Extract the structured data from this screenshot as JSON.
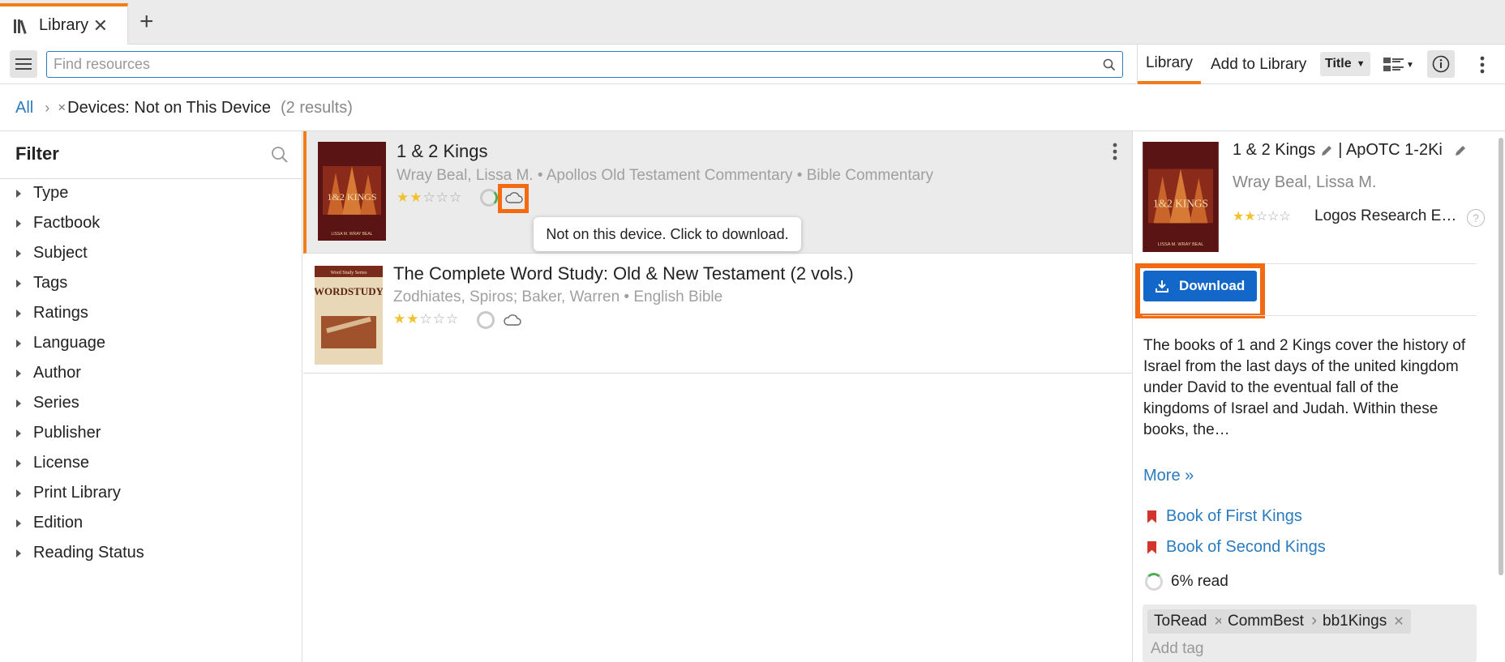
{
  "tabs": [
    {
      "label": "Library"
    }
  ],
  "search": {
    "placeholder": "Find resources",
    "value": ""
  },
  "toolbar": {
    "library_tab": "Library",
    "add_tab": "Add to Library",
    "sort_label": "Title"
  },
  "breadcrumb": {
    "all": "All",
    "filter": "Devices: Not on This Device",
    "results": "(2 results)"
  },
  "filter": {
    "title": "Filter",
    "items": [
      "Type",
      "Factbook",
      "Subject",
      "Tags",
      "Ratings",
      "Language",
      "Author",
      "Series",
      "Publisher",
      "License",
      "Print Library",
      "Edition",
      "Reading Status"
    ]
  },
  "results": [
    {
      "title": "1 & 2 Kings",
      "meta": "Wray Beal, Lissa M. • Apollos Old Testament Commentary • Bible Commentary",
      "rating": 2,
      "cover_title": "1&2 KINGS",
      "cover_author": "LISSA M. WRAY BEAL"
    },
    {
      "title": "The Complete Word Study: Old & New Testament  (2 vols.)",
      "meta": "Zodhiates, Spiros; Baker, Warren • English Bible",
      "rating": 2,
      "cover_series": "Word Study Series",
      "cover_title": "WORDSTUDY"
    }
  ],
  "tooltip": "Not on this device. Click to download.",
  "details": {
    "title": "1 & 2 Kings",
    "abbrev": "| ApOTC 1-2Ki",
    "author": "Wray Beal, Lissa M.",
    "rating": 2,
    "publisher": "Logos Research E…",
    "download_label": "Download",
    "description": "The books of 1 and 2 Kings cover the history of Israel from the last days of the united kingdom under David to the eventual fall of the kingdoms of Israel and Judah. Within these books, the…",
    "more": "More »",
    "links": [
      "Book of First Kings",
      "Book of Second Kings"
    ],
    "progress": "6% read",
    "progress_value": 0.06,
    "tags": [
      "ToRead",
      "CommBest",
      "bb1Kings"
    ],
    "tag_placeholder": "Add tag"
  },
  "colors": {
    "accent": "#f07d1a",
    "link": "#2b7bbf",
    "download": "#1267c8",
    "highlight": "#f26a12",
    "star": "#f2c12e"
  }
}
